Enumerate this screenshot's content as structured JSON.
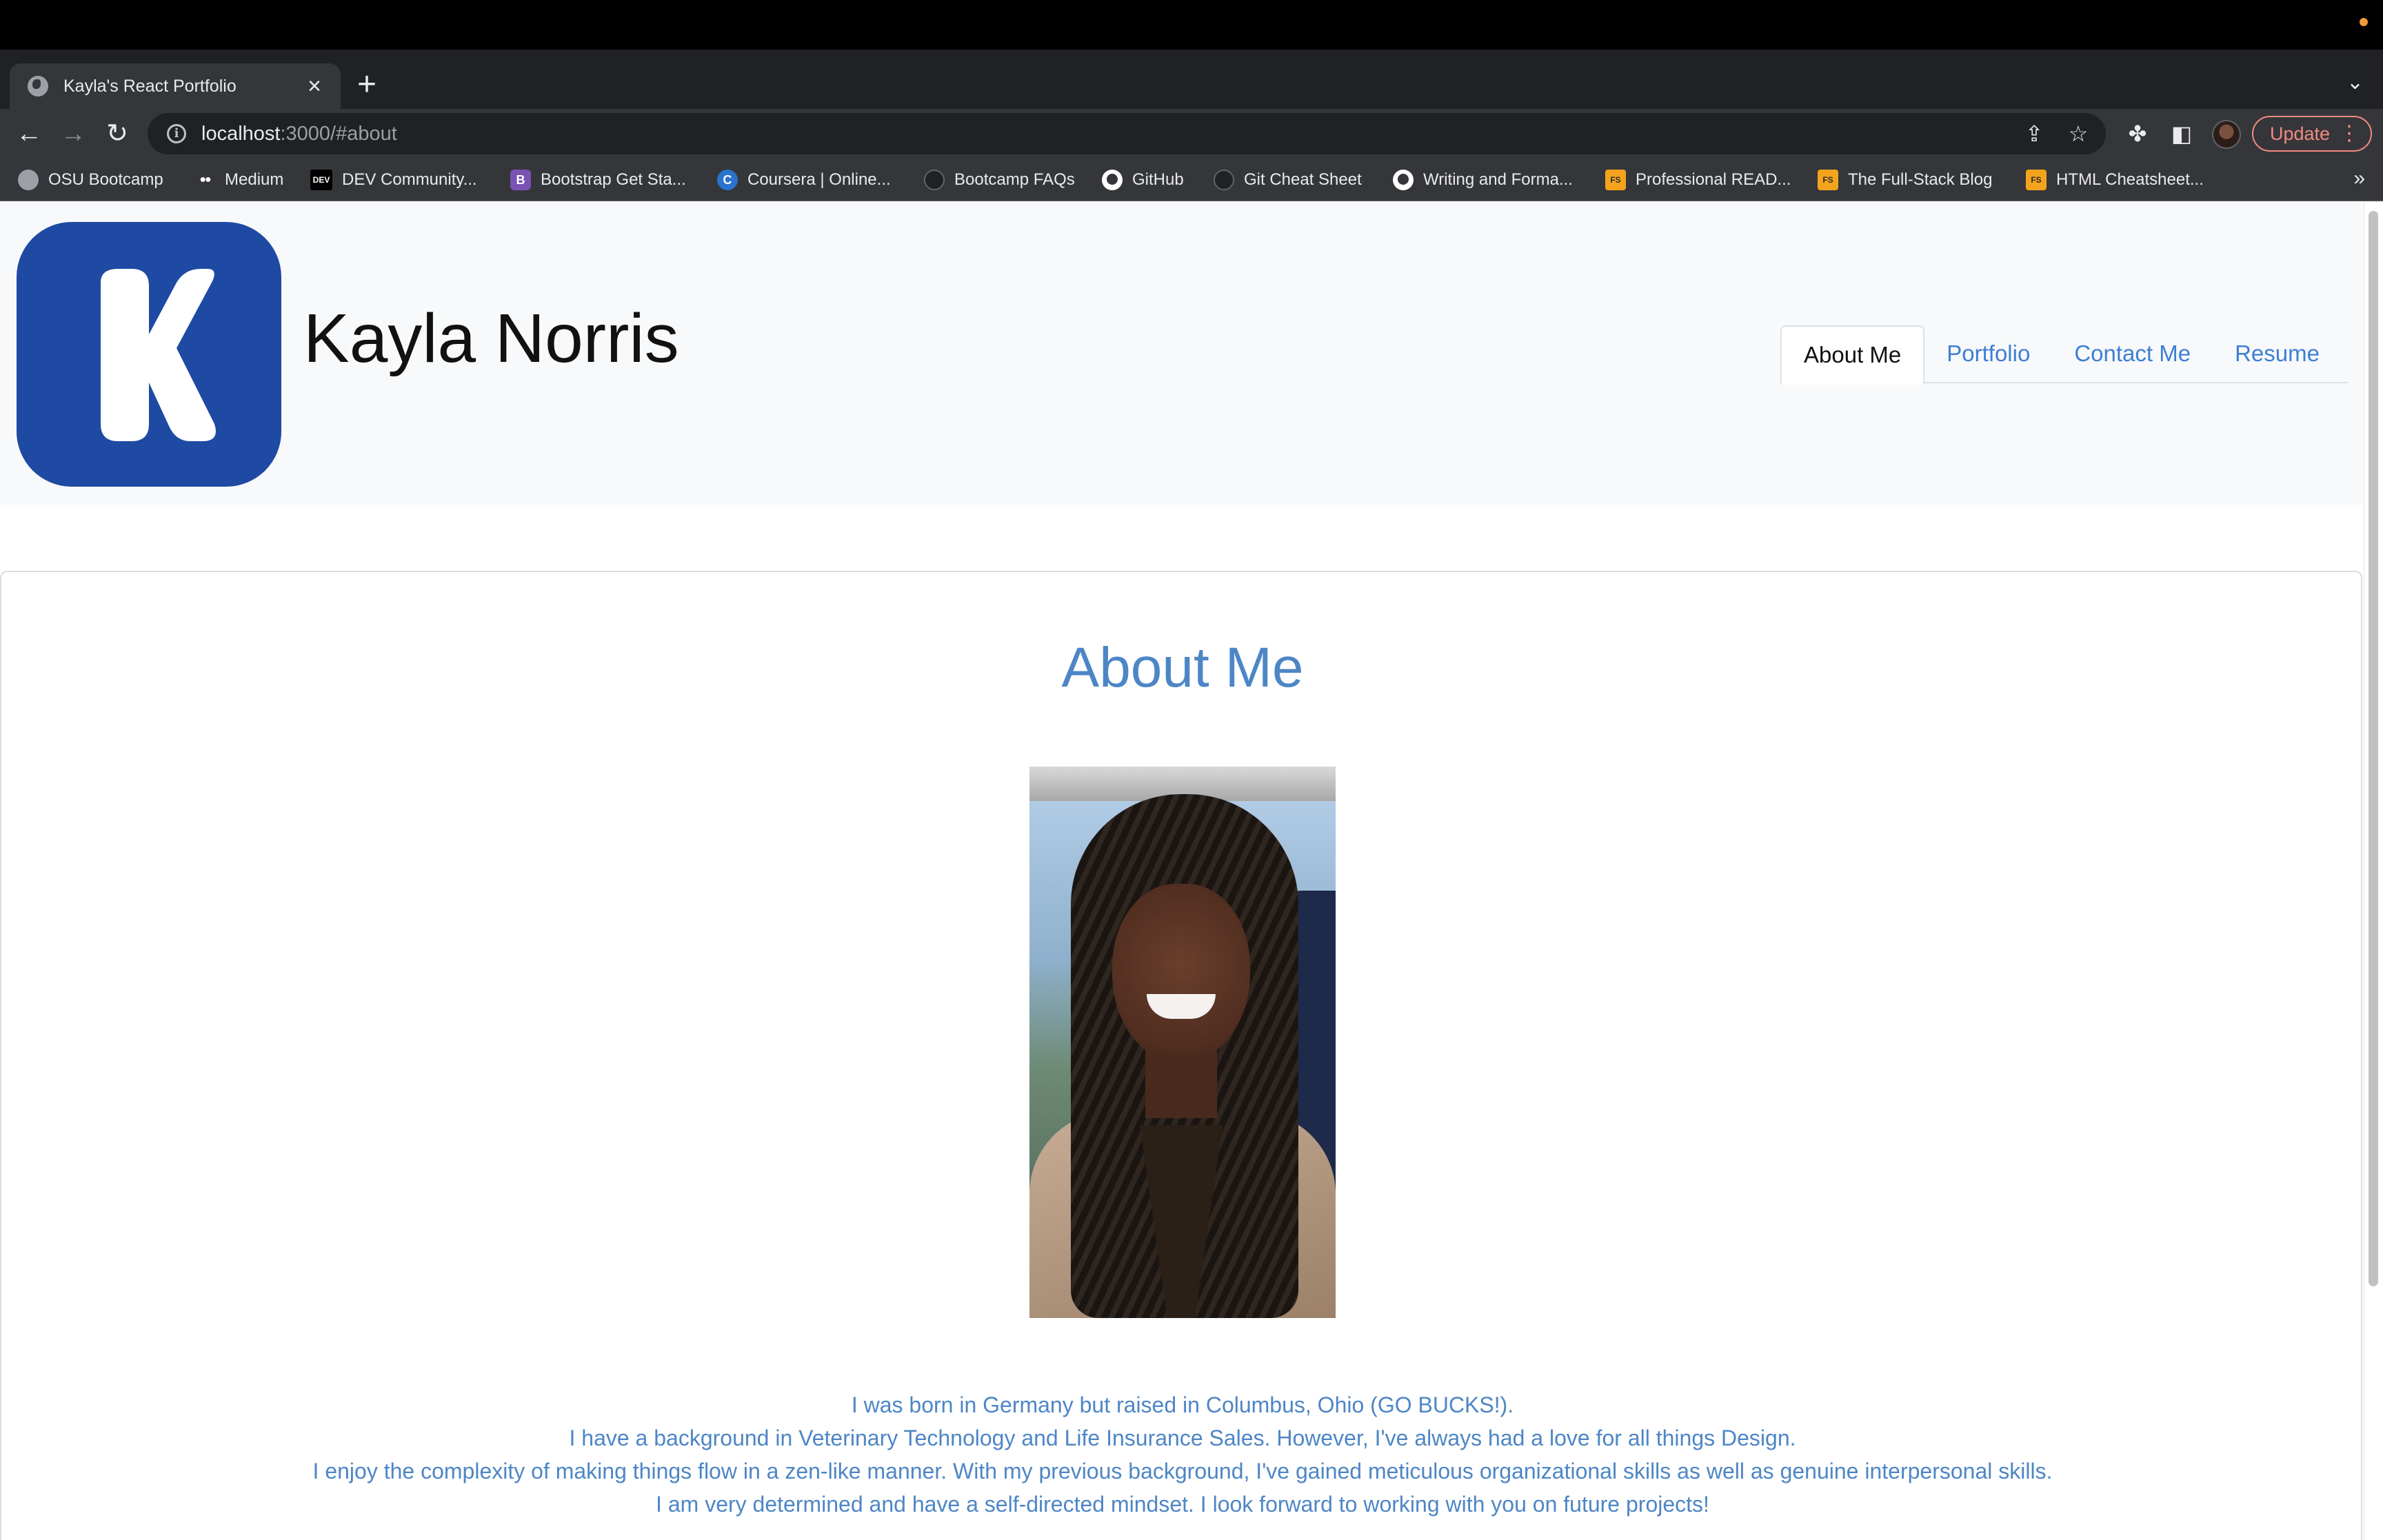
{
  "browser": {
    "tab_title": "Kayla's React Portfolio",
    "url_host": "localhost",
    "url_path": ":3000/#about",
    "update_label": "Update",
    "bookmarks": [
      {
        "label": "OSU Bootcamp",
        "icon": "globe-icon"
      },
      {
        "label": "Medium",
        "icon": "medium-icon"
      },
      {
        "label": "DEV Community...",
        "icon": "dev-icon",
        "glyph": "DEV"
      },
      {
        "label": "Bootstrap Get Sta...",
        "icon": "bootstrap-icon",
        "glyph": "B"
      },
      {
        "label": "Coursera | Online...",
        "icon": "coursera-icon",
        "glyph": "C"
      },
      {
        "label": "Bootcamp FAQs",
        "icon": "bootcamp-icon"
      },
      {
        "label": "GitHub",
        "icon": "github-icon"
      },
      {
        "label": "Git Cheat Sheet",
        "icon": "github-icon"
      },
      {
        "label": "Writing and Forma...",
        "icon": "github-icon"
      },
      {
        "label": "Professional READ...",
        "icon": "fullstack-icon",
        "glyph": "FS"
      },
      {
        "label": "The Full-Stack Blog",
        "icon": "fullstack-icon",
        "glyph": "FS"
      },
      {
        "label": "HTML Cheatsheet...",
        "icon": "fullstack-icon",
        "glyph": "FS"
      }
    ]
  },
  "header": {
    "logo_letter": "K",
    "name": "Kayla Norris",
    "nav": [
      {
        "label": "About Me",
        "active": true
      },
      {
        "label": "Portfolio",
        "active": false
      },
      {
        "label": "Contact Me",
        "active": false
      },
      {
        "label": "Resume",
        "active": false
      }
    ]
  },
  "about": {
    "heading": "About Me",
    "photo_alt": "Kayla Norris portrait",
    "bio": [
      "I was born in Germany but raised in Columbus, Ohio (GO BUCKS!).",
      "I have a background in Veterinary Technology and Life Insurance Sales. However, I've always had a love for all things Design.",
      "I enjoy the complexity of making things flow in a zen-like manner. With my previous background, I've gained meticulous organizational skills as well as genuine interpersonal skills.",
      "I am very determined and have a self-directed mindset. I look forward to working with you on future projects!"
    ]
  },
  "colors": {
    "accent": "#4d86c6",
    "link": "#3d7ed6",
    "logo_bg": "#1e4aa3",
    "header_bg": "#f8f9fa"
  }
}
